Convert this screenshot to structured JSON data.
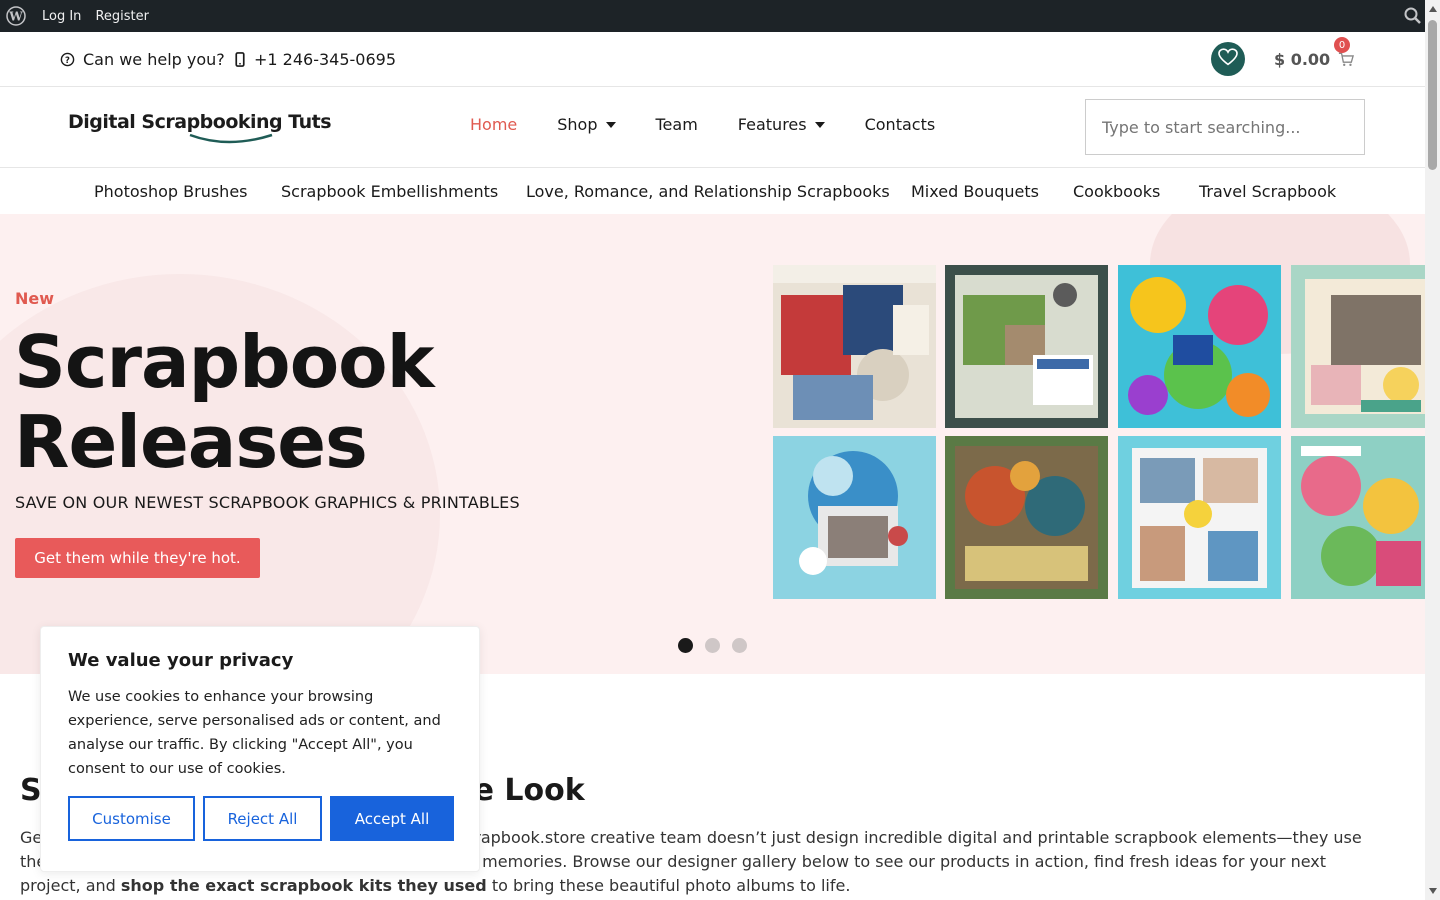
{
  "admin_bar": {
    "login": "Log In",
    "register": "Register"
  },
  "topbar": {
    "help_text": "Can we help you?",
    "phone": "+1 246-345-0695",
    "cart_total": "$ 0.00",
    "cart_count": "0"
  },
  "header": {
    "logo": "Digital Scrapbooking Tuts",
    "nav": [
      {
        "label": "Home",
        "active": true
      },
      {
        "label": "Shop",
        "dropdown": true
      },
      {
        "label": "Team"
      },
      {
        "label": "Features",
        "dropdown": true
      },
      {
        "label": "Contacts"
      }
    ],
    "search_placeholder": "Type to start searching..."
  },
  "categories": [
    "Photoshop Brushes",
    "Scrapbook Embellishments",
    "Love, Romance, and Relationship Scrapbooks",
    "Mixed Bouquets",
    "Cookbooks",
    "Travel Scrapbook"
  ],
  "hero": {
    "tag": "New",
    "title_line1": "Scrapbook",
    "title_line2": "Releases",
    "subtitle": "SAVE ON OUR NEWEST SCRAPBOOK GRAPHICS & PRINTABLES",
    "cta": "Get them while they're hot.",
    "slides": 3,
    "active_slide": 1
  },
  "content": {
    "title_start": "S",
    "title_end": "e Look",
    "text_start": "Ge",
    "text_middle": "rapbook.store creative team doesn’t just design incredible digital and printable scrapbook elements—they use them to craft stunning photo album layouts for their own memories. Browse our designer gallery below to see our products in action, find fresh ideas for your next project, and ",
    "text_bold": "shop the exact scrapbook kits they used",
    "text_end": " to bring these beautiful photo albums to life."
  },
  "cookie": {
    "title": "We value your privacy",
    "body": "We use cookies to enhance your browsing experience, serve personalised ads or content, and analyse our traffic. By clicking \"Accept All\", you consent to our use of cookies.",
    "customise": "Customise",
    "reject": "Reject All",
    "accept": "Accept All"
  },
  "colors": {
    "accent": "#e85a5a",
    "brand_dark": "#1f5c56",
    "cookie_blue": "#1863dc",
    "hero_bg": "#fdf0f0"
  }
}
